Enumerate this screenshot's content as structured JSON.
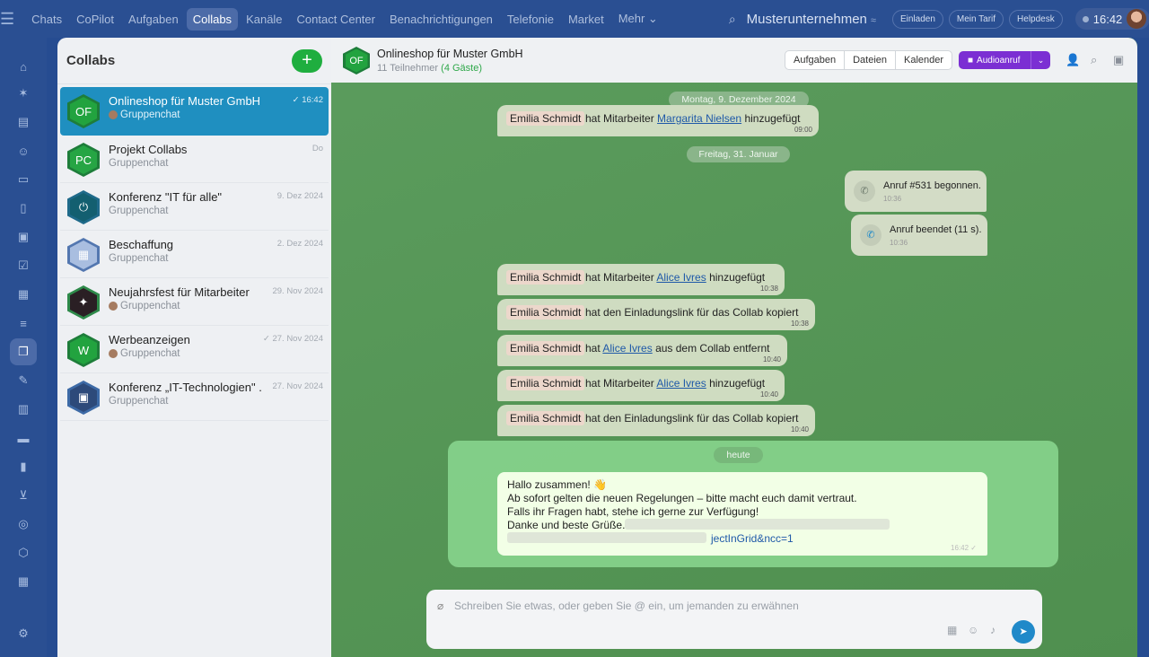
{
  "topbar": {
    "menu": [
      "Chats",
      "CoPilot",
      "Aufgaben",
      "Collabs",
      "Kanäle",
      "Contact Center",
      "Benachrichtigungen",
      "Telefonie",
      "Market",
      "Mehr ⌄"
    ],
    "company": "Musterunternehmen",
    "company_suffix": "≈",
    "invite": "Einladen",
    "tariff": "Mein Tarif",
    "helpdesk": "Helpdesk",
    "time": "16:42"
  },
  "sidebar": {
    "title": "Collabs",
    "add_label": "+",
    "items": [
      {
        "initials": "OF",
        "name": "Onlineshop für Muster GmbH",
        "sub": "Gruppenchat",
        "date": "✓ 16:42",
        "icon": "group-avatar-icon"
      },
      {
        "initials": "PC",
        "name": "Projekt Collabs",
        "sub": "Gruppenchat",
        "date": "Do",
        "icon": ""
      },
      {
        "initials": "⏻",
        "name": "Konferenz \"IT für alle\"",
        "sub": "Gruppenchat",
        "date": "9. Dez 2024",
        "icon": ""
      },
      {
        "initials": "▦",
        "name": "Beschaffung",
        "sub": "Gruppenchat",
        "date": "2. Dez 2024",
        "icon": ""
      },
      {
        "initials": "✦",
        "name": "Neujahrsfest für Mitarbeiter",
        "sub": "Gruppenchat",
        "date": "29. Nov 2024",
        "icon": "group-avatar-icon"
      },
      {
        "initials": "W",
        "name": "Werbeanzeigen",
        "sub": "Gruppenchat",
        "date": "✓ 27. Nov 2024",
        "icon": "group-avatar-icon"
      },
      {
        "initials": "▣",
        "name": "Konferenz „IT-Technologien\" ...",
        "sub": "Gruppenchat",
        "date": "27. Nov 2024",
        "icon": ""
      }
    ]
  },
  "chat": {
    "initials": "OF",
    "title": "Onlineshop für Muster GmbH",
    "members": "11 Teilnehmer",
    "guests": "(4 Gäste)",
    "tabs": [
      "Aufgaben",
      "Dateien",
      "Kalender"
    ],
    "audio": "Audioanruf",
    "date1": "Montag, 9. Dezember 2024",
    "date2": "Freitag, 31. Januar",
    "today": "heute",
    "msgs": [
      {
        "who": "Emilia Schmidt",
        "pre": "hat Mitarbeiter",
        "link": "Margarita Nielsen",
        "post": "hinzugefügt",
        "time": "09:00"
      },
      {
        "who": "Emilia Schmidt",
        "pre": "hat Mitarbeiter",
        "link": "Alice Ivres",
        "post": "hinzugefügt",
        "time": "10:38"
      },
      {
        "who": "Emilia Schmidt",
        "pre": "hat den Einladungslink für das Collab kopiert",
        "link": "",
        "post": "",
        "time": "10:38"
      },
      {
        "who": "Emilia Schmidt",
        "pre": "hat",
        "link": "Alice Ivres",
        "post": "aus dem Collab entfernt",
        "time": "10:40"
      },
      {
        "who": "Emilia Schmidt",
        "pre": "hat Mitarbeiter",
        "link": "Alice Ivres",
        "post": "hinzugefügt",
        "time": "10:40"
      },
      {
        "who": "Emilia Schmidt",
        "pre": "hat den Einladungslink für das Collab kopiert",
        "link": "",
        "post": "",
        "time": "10:40"
      }
    ],
    "call1": {
      "text": "Anruf #531 begonnen.",
      "time": "10:36"
    },
    "call2": {
      "text": "Anruf beendet (11 s).",
      "time": "10:36"
    },
    "post": {
      "l1": "Hallo zusammen! 👋",
      "l2": "Ab sofort gelten die neuen Regelungen – bitte macht euch damit vertraut.",
      "l3": "Falls ihr Fragen habt, stehe ich gerne zur Verfügung!",
      "l4": "Danke und beste Grüße.",
      "l5": "jectInGrid&ncc=1",
      "time": "16:42 ✓"
    },
    "placeholder": "Schreiben Sie etwas, oder geben Sie @ ein, um jemanden zu erwähnen"
  }
}
